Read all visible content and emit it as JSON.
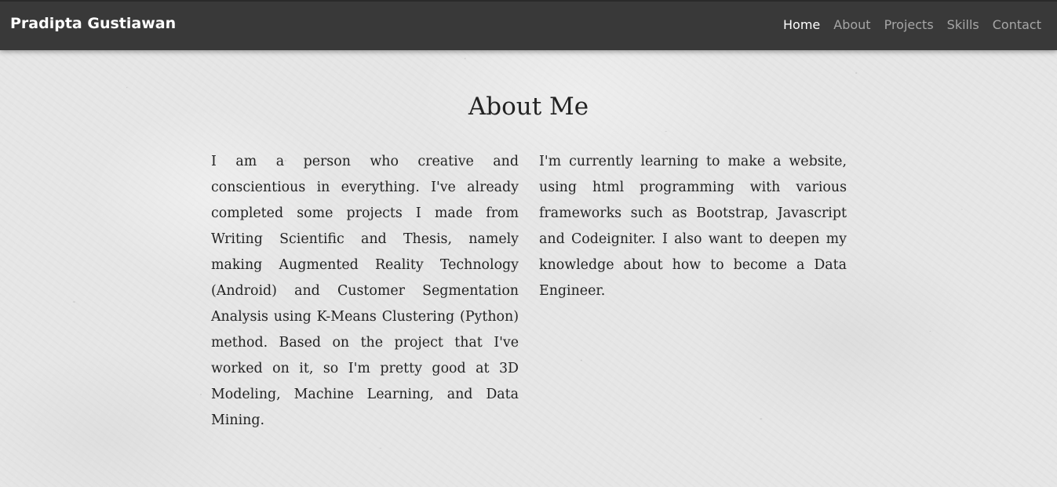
{
  "navbar": {
    "brand": "Pradipta Gustiawan",
    "links": [
      {
        "label": "Home",
        "active": true
      },
      {
        "label": "About",
        "active": false
      },
      {
        "label": "Projects",
        "active": false
      },
      {
        "label": "Skills",
        "active": false
      },
      {
        "label": "Contact",
        "active": false
      }
    ]
  },
  "about": {
    "title": "About Me",
    "paragraph_left": "I am a person who creative and conscientious in everything. I've already completed some projects I made from Writing Scientific and Thesis, namely making Augmented Reality Technology (Android) and Customer Segmentation Analysis using K-Means Clustering (Python) method. Based on the project that I've worked on it, so I'm pretty good at 3D Modeling, Machine Learning, and Data Mining.",
    "paragraph_right": "I'm currently learning to make a website, using html programming with various frameworks such as Bootstrap, Javascript and Codeigniter. I also want to deepen my knowledge about how to become a Data Engineer."
  },
  "colors": {
    "navbar_bg": "#393939",
    "nav_active": "#ffffff",
    "nav_inactive": "#a6a6a6",
    "text": "#222222",
    "page_bg": "#e6e6e6"
  }
}
